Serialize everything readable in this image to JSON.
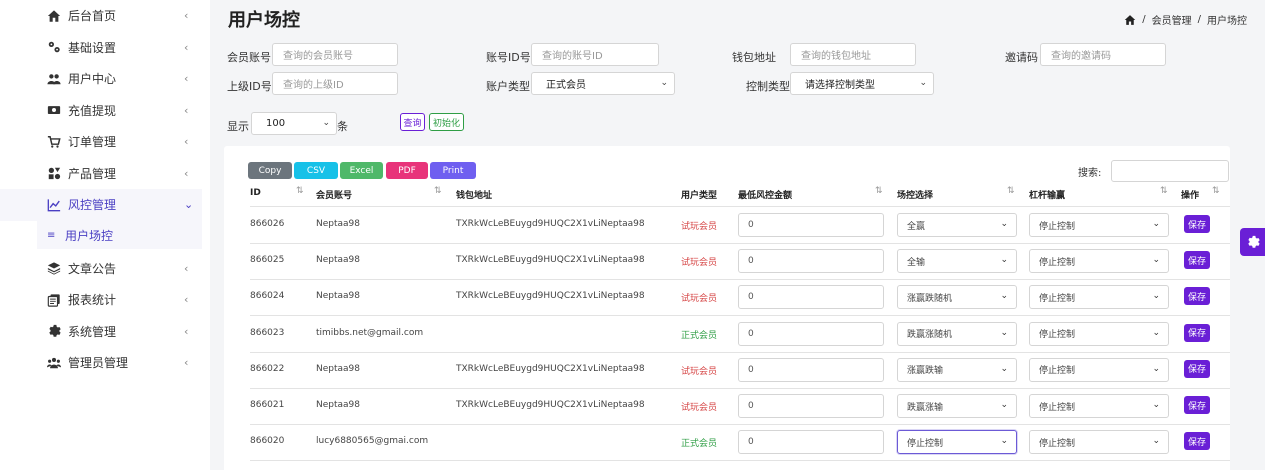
{
  "sidebar": {
    "items": [
      {
        "label": "后台首页",
        "icon": "home-icon",
        "active": false
      },
      {
        "label": "基础设置",
        "icon": "gears-icon",
        "active": false
      },
      {
        "label": "用户中心",
        "icon": "users-icon",
        "active": false
      },
      {
        "label": "充值提现",
        "icon": "money-icon",
        "active": false
      },
      {
        "label": "订单管理",
        "icon": "cart-icon",
        "active": false
      },
      {
        "label": "产品管理",
        "icon": "product-icon",
        "active": false
      },
      {
        "label": "风控管理",
        "icon": "chart-line-icon",
        "active": true
      },
      {
        "label": "文章公告",
        "icon": "layers-icon",
        "active": false
      },
      {
        "label": "报表统计",
        "icon": "report-icon",
        "active": false
      },
      {
        "label": "系统管理",
        "icon": "gear-icon",
        "active": false
      },
      {
        "label": "管理员管理",
        "icon": "admin-users-icon",
        "active": false
      }
    ],
    "sub_item": {
      "label": "用户场控",
      "icon": "list-icon"
    }
  },
  "header": {
    "title": "用户场控",
    "breadcrumb": [
      "会员管理",
      "用户场控"
    ],
    "breadcrumb_sep": "/"
  },
  "filters": {
    "member_account": {
      "label": "会员账号",
      "placeholder": "查询的会员账号"
    },
    "account_id": {
      "label": "账号ID号",
      "placeholder": "查询的账号ID"
    },
    "wallet": {
      "label": "钱包地址",
      "placeholder": "查询的钱包地址"
    },
    "invite": {
      "label": "邀请码",
      "placeholder": "查询的邀请码"
    },
    "parent_id": {
      "label": "上级ID号",
      "placeholder": "查询的上级ID"
    },
    "account_type": {
      "label": "账户类型",
      "value": "正式会员"
    },
    "control_type": {
      "label": "控制类型",
      "value": "请选择控制类型"
    },
    "show_label": "显示",
    "page_size": "100",
    "unit": "条",
    "query_btn": "查询",
    "reset_btn": "初始化"
  },
  "export": {
    "copy": "Copy",
    "csv": "CSV",
    "excel": "Excel",
    "pdf": "PDF",
    "print": "Print",
    "search_label": "搜索:"
  },
  "colors": {
    "copy": "#6c757d",
    "csv": "#17c1e8",
    "excel": "#4fb869",
    "pdf": "#e8347a",
    "print": "#6f5ff0",
    "accent": "#6a1fd6",
    "trial": "#d64545",
    "formal": "#2f9e45"
  },
  "table": {
    "headers": [
      "ID",
      "会员账号",
      "钱包地址",
      "用户类型",
      "最低风控金额",
      "场控选择",
      "杠杆输赢",
      "操作"
    ],
    "save_label": "保存",
    "rows": [
      {
        "id": "866026",
        "account": "Neptaa98",
        "wallet": "TXRkWcLeBEuygd9HUQC2X1vLiNeptaa98",
        "type": "试玩会员",
        "type_kind": "trial",
        "amount": "0",
        "control": "全赢",
        "leverage": "停止控制",
        "focus": false
      },
      {
        "id": "866025",
        "account": "Neptaa98",
        "wallet": "TXRkWcLeBEuygd9HUQC2X1vLiNeptaa98",
        "type": "试玩会员",
        "type_kind": "trial",
        "amount": "0",
        "control": "全输",
        "leverage": "停止控制",
        "focus": false
      },
      {
        "id": "866024",
        "account": "Neptaa98",
        "wallet": "TXRkWcLeBEuygd9HUQC2X1vLiNeptaa98",
        "type": "试玩会员",
        "type_kind": "trial",
        "amount": "0",
        "control": "涨赢跌随机",
        "leverage": "停止控制",
        "focus": false
      },
      {
        "id": "866023",
        "account": "timibbs.net@gmail.com",
        "wallet": "",
        "type": "正式会员",
        "type_kind": "formal",
        "amount": "0",
        "control": "跌赢涨随机",
        "leverage": "停止控制",
        "focus": false
      },
      {
        "id": "866022",
        "account": "Neptaa98",
        "wallet": "TXRkWcLeBEuygd9HUQC2X1vLiNeptaa98",
        "type": "试玩会员",
        "type_kind": "trial",
        "amount": "0",
        "control": "涨赢跌输",
        "leverage": "停止控制",
        "focus": false
      },
      {
        "id": "866021",
        "account": "Neptaa98",
        "wallet": "TXRkWcLeBEuygd9HUQC2X1vLiNeptaa98",
        "type": "试玩会员",
        "type_kind": "trial",
        "amount": "0",
        "control": "跌赢涨输",
        "leverage": "停止控制",
        "focus": false
      },
      {
        "id": "866020",
        "account": "lucy6880565@gmai.com",
        "wallet": "",
        "type": "正式会员",
        "type_kind": "formal",
        "amount": "0",
        "control": "停止控制",
        "leverage": "停止控制",
        "focus": true
      }
    ]
  }
}
